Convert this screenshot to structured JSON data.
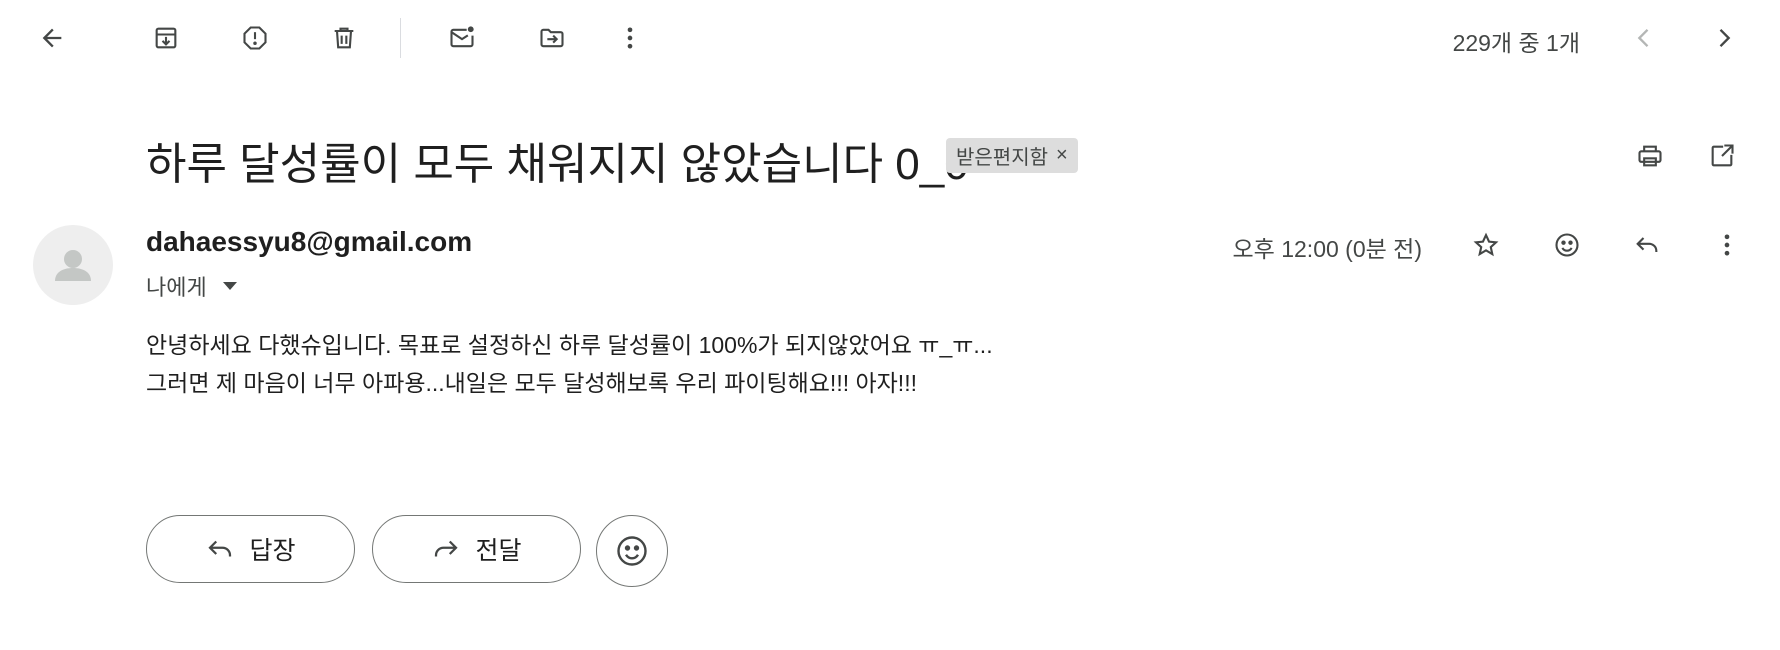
{
  "toolbar": {
    "icons": [
      "back-arrow-icon",
      "archive-icon",
      "report-spam-icon",
      "delete-icon",
      "mark-unread-icon",
      "move-to-icon",
      "more-vert-icon"
    ],
    "counter": "229개 중 1개",
    "nav_icons": [
      "chevron-left-icon",
      "chevron-right-icon"
    ]
  },
  "message": {
    "subject": "하루 달성률이 모두 채워지지 않았습니다 0_0",
    "label": "받은편지함",
    "label_remove": "×",
    "sender": "dahaessyu8@gmail.com",
    "to": "나에게",
    "time": "오후 12:00 (0분 전)",
    "body_lines": [
      "안녕하세요 다했슈입니다. 목표로 설정하신 하루 달성률이 100%가 되지않았어요 ㅠ_ㅠ...",
      "그러면 제 마음이 너무 아파용...내일은 모두 달성해보록 우리 파이팅해요!!! 아자!!!"
    ]
  },
  "actions": {
    "reply_label": "답장",
    "forward_label": "전달"
  },
  "colors": {
    "text": "#1f1f1f",
    "secondary": "#444746",
    "chip_bg": "#dddddd",
    "avatar_bg": "#eeeeee"
  }
}
